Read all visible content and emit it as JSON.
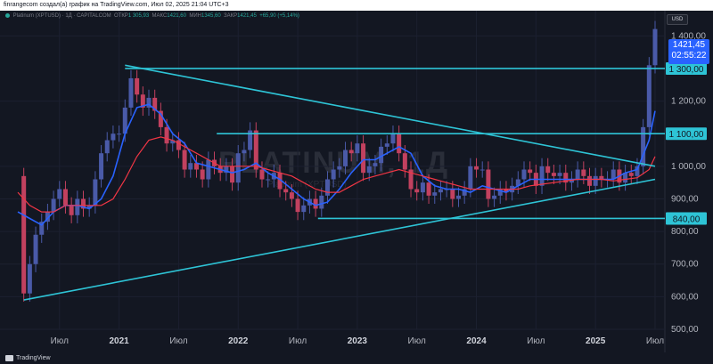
{
  "header": {
    "caption": "finrangecom создал(а) график на TradingView.com, Июл 02, 2025 21:04 UTC+3"
  },
  "legend": {
    "symbol": "Platinum (XPTUSD) · 1Д · CAPITALCOM",
    "open_label": "ОТКР",
    "open_value": "1 305,93",
    "high_label": "МАКС",
    "high_value": "1421,60",
    "low_label": "МИН",
    "low_value": "1345,60",
    "close_label": "ЗАКР",
    "close_value": "1421,45",
    "change_value": "+65,90 (+5,14%)"
  },
  "currency_button": "USD",
  "watermark": {
    "text": "PLATINUM, 1Д",
    "sub": "Platinum (XPTUSD)"
  },
  "price_tag": {
    "price": "1421,45",
    "countdown": "02:55:22"
  },
  "level_tags": [
    {
      "label": "1 300,00",
      "value": 1300
    },
    {
      "label": "1 100,00",
      "value": 1100
    },
    {
      "label": "840,00",
      "value": 840
    }
  ],
  "footer": {
    "brand": "TradingView"
  },
  "colors": {
    "bg": "#131722",
    "up": "#26a69a",
    "down": "#ef5350",
    "level": "#2ec4d6",
    "ma_fast": "#2962ff",
    "ma_slow": "#f23645",
    "candle_up": "#4a5aa8",
    "candle_down": "#c2415f"
  },
  "chart_data": {
    "type": "line",
    "title": "Platinum (XPTUSD) · 1Д · CAPITALCOM",
    "xlabel": "",
    "ylabel": "",
    "ylim": [
      500,
      1500
    ],
    "y_ticks": [
      {
        "label": "1 400,00",
        "value": 1400
      },
      {
        "label": "1 200,00",
        "value": 1200
      },
      {
        "label": "1 000,00",
        "value": 1000
      },
      {
        "label": "900,00",
        "value": 900
      },
      {
        "label": "800,00",
        "value": 800
      },
      {
        "label": "700,00",
        "value": 700
      },
      {
        "label": "600,00",
        "value": 600
      },
      {
        "label": "500,00",
        "value": 500
      }
    ],
    "x_ticks": [
      {
        "label": "Июл",
        "t": 2020.5,
        "bold": false
      },
      {
        "label": "2021",
        "t": 2021.0,
        "bold": true
      },
      {
        "label": "Июл",
        "t": 2021.5,
        "bold": false
      },
      {
        "label": "2022",
        "t": 2022.0,
        "bold": true
      },
      {
        "label": "Июл",
        "t": 2022.5,
        "bold": false
      },
      {
        "label": "2023",
        "t": 2023.0,
        "bold": true
      },
      {
        "label": "Июл",
        "t": 2023.5,
        "bold": false
      },
      {
        "label": "2024",
        "t": 2024.0,
        "bold": true
      },
      {
        "label": "Июл",
        "t": 2024.5,
        "bold": false
      },
      {
        "label": "2025",
        "t": 2025.0,
        "bold": true
      },
      {
        "label": "Июл",
        "t": 2025.5,
        "bold": false
      }
    ],
    "x_range": [
      2020.1,
      2025.5
    ],
    "horizontal_levels": [
      {
        "value": 1300,
        "t_start": 2021.05,
        "t_end": 2025.95
      },
      {
        "value": 1100,
        "t_start": 2021.82,
        "t_end": 2025.95
      },
      {
        "value": 840,
        "t_start": 2022.67,
        "t_end": 2025.95
      }
    ],
    "trendlines": [
      {
        "from": [
          2021.05,
          1310
        ],
        "to": [
          2025.5,
          1000
        ]
      },
      {
        "from": [
          2020.2,
          590
        ],
        "to": [
          2025.5,
          960
        ]
      }
    ],
    "series": [
      {
        "name": "",
        "kind": "price",
        "x": [
          2020.15,
          2020.2,
          2020.25,
          2020.3,
          2020.35,
          2020.4,
          2020.45,
          2020.5,
          2020.55,
          2020.6,
          2020.65,
          2020.7,
          2020.75,
          2020.8,
          2020.85,
          2020.9,
          2020.95,
          2021.0,
          2021.05,
          2021.1,
          2021.15,
          2021.2,
          2021.25,
          2021.3,
          2021.35,
          2021.4,
          2021.45,
          2021.5,
          2021.55,
          2021.6,
          2021.65,
          2021.7,
          2021.75,
          2021.8,
          2021.85,
          2021.9,
          2021.95,
          2022.0,
          2022.05,
          2022.1,
          2022.15,
          2022.2,
          2022.25,
          2022.3,
          2022.35,
          2022.4,
          2022.45,
          2022.5,
          2022.55,
          2022.6,
          2022.65,
          2022.7,
          2022.75,
          2022.8,
          2022.85,
          2022.9,
          2022.95,
          2023.0,
          2023.05,
          2023.1,
          2023.15,
          2023.2,
          2023.25,
          2023.3,
          2023.35,
          2023.4,
          2023.45,
          2023.5,
          2023.55,
          2023.6,
          2023.65,
          2023.7,
          2023.75,
          2023.8,
          2023.85,
          2023.9,
          2023.95,
          2024.0,
          2024.05,
          2024.1,
          2024.15,
          2024.2,
          2024.25,
          2024.3,
          2024.35,
          2024.4,
          2024.45,
          2024.5,
          2024.55,
          2024.6,
          2024.65,
          2024.7,
          2024.75,
          2024.8,
          2024.85,
          2024.9,
          2024.95,
          2025.0,
          2025.05,
          2025.1,
          2025.15,
          2025.2,
          2025.25,
          2025.3,
          2025.35,
          2025.4,
          2025.45,
          2025.5
        ],
        "y": [
          970,
          610,
          700,
          790,
          830,
          860,
          900,
          930,
          880,
          850,
          900,
          870,
          880,
          960,
          1040,
          1080,
          1100,
          1100,
          1180,
          1270,
          1220,
          1180,
          1210,
          1170,
          1120,
          1070,
          1080,
          1050,
          990,
          1010,
          990,
          960,
          1020,
          1000,
          980,
          1000,
          950,
          1040,
          1050,
          1110,
          990,
          960,
          960,
          980,
          930,
          920,
          900,
          860,
          880,
          900,
          870,
          910,
          960,
          990,
          1000,
          1050,
          1040,
          1070,
          980,
          1000,
          1010,
          1060,
          1070,
          1100,
          1040,
          990,
          930,
          920,
          950,
          910,
          920,
          930,
          930,
          900,
          910,
          930,
          1000,
          990,
          990,
          900,
          910,
          930,
          920,
          940,
          960,
          990,
          980,
          940,
          1000,
          980,
          970,
          980,
          950,
          960,
          990,
          970,
          940,
          970,
          960,
          960,
          990,
          950,
          980,
          970,
          1000,
          1120,
          1310,
          1421
        ]
      },
      {
        "name": "",
        "kind": "ma_fast",
        "x": [
          2020.15,
          2020.25,
          2020.35,
          2020.45,
          2020.55,
          2020.65,
          2020.75,
          2020.85,
          2020.95,
          2021.05,
          2021.15,
          2021.25,
          2021.35,
          2021.45,
          2021.55,
          2021.65,
          2021.75,
          2021.85,
          2021.95,
          2022.05,
          2022.15,
          2022.25,
          2022.35,
          2022.45,
          2022.55,
          2022.65,
          2022.75,
          2022.85,
          2022.95,
          2023.05,
          2023.15,
          2023.25,
          2023.35,
          2023.45,
          2023.55,
          2023.65,
          2023.75,
          2023.85,
          2023.95,
          2024.05,
          2024.15,
          2024.25,
          2024.35,
          2024.45,
          2024.55,
          2024.65,
          2024.75,
          2024.85,
          2024.95,
          2025.05,
          2025.15,
          2025.25,
          2025.35,
          2025.45,
          2025.5
        ],
        "y": [
          860,
          840,
          820,
          860,
          880,
          880,
          870,
          900,
          970,
          1100,
          1180,
          1190,
          1160,
          1100,
          1070,
          1010,
          1000,
          990,
          980,
          990,
          1010,
          980,
          960,
          930,
          900,
          880,
          890,
          930,
          980,
          1020,
          1020,
          1040,
          1060,
          1040,
          970,
          940,
          930,
          930,
          920,
          940,
          930,
          920,
          940,
          960,
          960,
          960,
          960,
          960,
          960,
          960,
          960,
          980,
          990,
          1080,
          1170
        ]
      },
      {
        "name": "",
        "kind": "ma_slow",
        "x": [
          2020.15,
          2020.25,
          2020.35,
          2020.45,
          2020.55,
          2020.65,
          2020.75,
          2020.85,
          2020.95,
          2021.05,
          2021.15,
          2021.25,
          2021.35,
          2021.45,
          2021.55,
          2021.65,
          2021.75,
          2021.85,
          2021.95,
          2022.05,
          2022.15,
          2022.25,
          2022.35,
          2022.45,
          2022.55,
          2022.65,
          2022.75,
          2022.85,
          2022.95,
          2023.05,
          2023.15,
          2023.25,
          2023.35,
          2023.45,
          2023.55,
          2023.65,
          2023.75,
          2023.85,
          2023.95,
          2024.05,
          2024.15,
          2024.25,
          2024.35,
          2024.45,
          2024.55,
          2024.65,
          2024.75,
          2024.85,
          2024.95,
          2025.05,
          2025.15,
          2025.25,
          2025.35,
          2025.45,
          2025.5
        ],
        "y": [
          920,
          880,
          860,
          860,
          880,
          880,
          880,
          880,
          900,
          960,
          1030,
          1080,
          1090,
          1080,
          1060,
          1040,
          1020,
          1000,
          1000,
          1000,
          1000,
          990,
          980,
          970,
          950,
          930,
          920,
          920,
          940,
          960,
          970,
          980,
          990,
          980,
          970,
          960,
          950,
          940,
          930,
          930,
          930,
          930,
          930,
          940,
          945,
          950,
          955,
          960,
          960,
          960,
          955,
          960,
          965,
          990,
          1030
        ]
      }
    ]
  }
}
